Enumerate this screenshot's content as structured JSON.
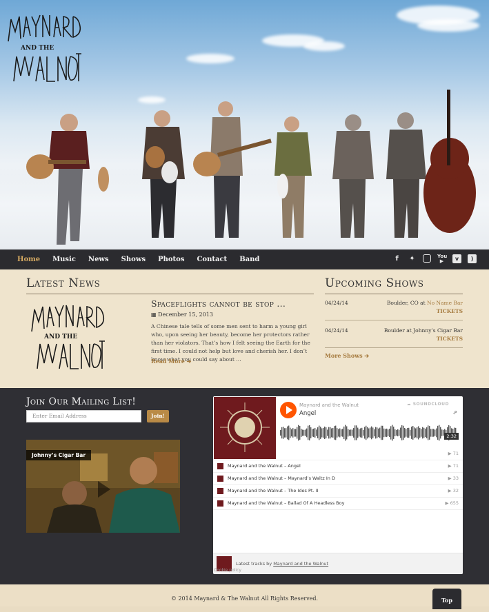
{
  "band": {
    "logo_text": "Maynard and the Walnut"
  },
  "nav": {
    "items": [
      {
        "label": "Home",
        "active": true
      },
      {
        "label": "Music"
      },
      {
        "label": "News"
      },
      {
        "label": "Shows"
      },
      {
        "label": "Photos"
      },
      {
        "label": "Contact"
      },
      {
        "label": "Band"
      }
    ],
    "social": [
      "facebook-icon",
      "twitter-icon",
      "instagram-icon",
      "youtube-icon",
      "vimeo-icon",
      "rss-icon"
    ]
  },
  "news": {
    "heading": "Latest News",
    "title": "Spaceflights cannot be stop ...",
    "date": "December 15, 2013",
    "body": "A Chinese tale tells of some men sent to harm a young girl who, upon seeing her beauty, become her protectors rather than her violators. That’s how I felt seeing the Earth for the first time. I could not help but love and cherish her. I don’t know what you could say about ...",
    "read_more": "Read More"
  },
  "shows": {
    "heading": "Upcoming Shows",
    "items": [
      {
        "date": "04/24/14",
        "location": "Boulder, CO at ",
        "venue": "No Name Bar",
        "tickets": "TICKETS"
      },
      {
        "date": "04/24/14",
        "location": "Boulder at Johnny’s Cigar Bar",
        "venue": "",
        "tickets": "TICKETS"
      }
    ],
    "more": "More Shows"
  },
  "mailing": {
    "title": "Join Our Mailing List!",
    "placeholder": "Enter Email Address",
    "button": "Join!"
  },
  "video": {
    "label": "Johnny’s Cigar Bar"
  },
  "soundcloud": {
    "brand": "SOUNDCLOUD",
    "artist": "Maynard and the Walnut",
    "track": "Angel",
    "duration": "2:32",
    "plays": "71",
    "tracks": [
      {
        "name": "Maynard and the Walnut – Angel",
        "plays": "71"
      },
      {
        "name": "Maynard and the Walnut – Maynard’s Waltz In D",
        "plays": "33"
      },
      {
        "name": "Maynard and the Walnut – The Ides Pt. II",
        "plays": "32"
      },
      {
        "name": "Maynard and the Walnut – Ballad Of A Headless Boy",
        "plays": "655"
      }
    ],
    "footer_prefix": "Latest tracks by ",
    "footer_link": "Maynard and the Walnut",
    "cookie": "Cookie policy"
  },
  "footer": {
    "copyright": "© 2014 Maynard & The Walnut All Rights Reserved.",
    "top": "Top"
  }
}
